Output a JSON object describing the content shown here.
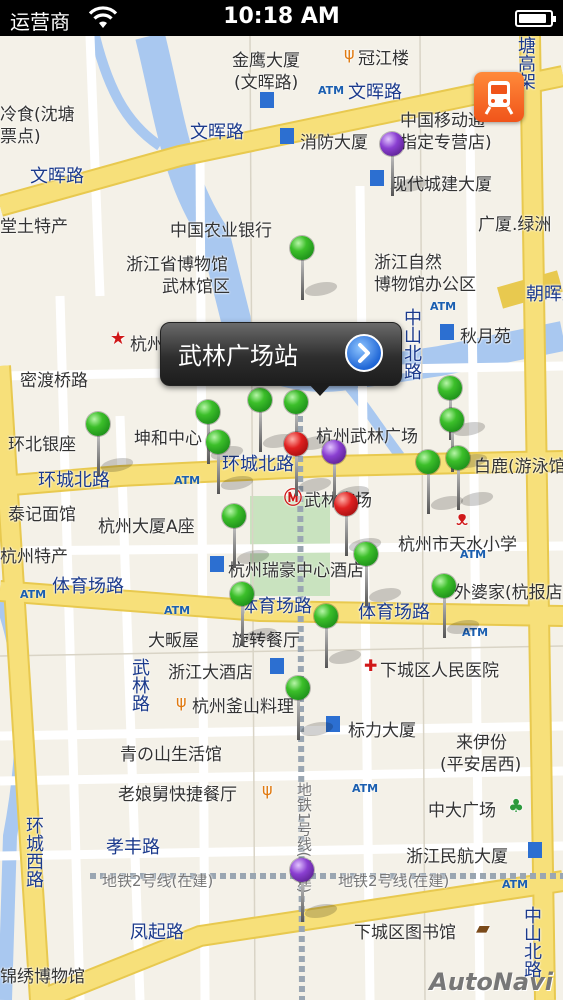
{
  "status_bar": {
    "carrier": "运营商",
    "time": "10:18 AM",
    "battery_level": 0.9
  },
  "callout": {
    "title": "武林广场站"
  },
  "watermark": "AutoNavi",
  "roads": {
    "wenhui_1": "文晖路",
    "wenhui_2": "文晖路",
    "wenhui_3": "文晖路",
    "huanchengbei_1": "环城北路",
    "huanchengbei_2": "环城北路",
    "tiyuchang_1": "体育场路",
    "tiyuchang_2": "体育场路",
    "tiyuchang_3": "体育场路",
    "zhongshanbei_1": "中山北路",
    "zhongshanbei_2": "中山北路",
    "fengqi": "凤起路",
    "wulin": "武林路",
    "huanchengxi": "环城西路",
    "xiaofeng": "孝丰路",
    "midu_bridge": "密渡桥路",
    "tangqiao": "塘高架",
    "chaohui": "朝晖路",
    "metro1": "地铁1号线(在建)",
    "metro2a": "地铁2号线(在建)",
    "metro2b": "地铁2号线(在建)"
  },
  "places": {
    "jinying": "金鹰大厦",
    "jinying_sub": "(文晖路)",
    "guanjilou": "冠江楼",
    "lengshi": "冷食(沈塘",
    "lengshi_sub": "票点)",
    "chinamobile": "中国移动通",
    "chinamobile_sub": "指定专营店)",
    "xiaofang": "消防大厦",
    "xiandai": "现代城建大厦",
    "tangtu": "堂土特产",
    "abc": "中国农业银行",
    "guangxia": "广厦.绿洲",
    "zj_museum": "浙江省博物馆",
    "zj_museum_sub": "武林馆区",
    "zj_nature": "浙江自然",
    "zj_nature_sub": "博物馆办公区",
    "exam": "杭州市教育考试院",
    "qiuyue": "秋月苑",
    "wulin_sq": "杭州武林广场",
    "huanbei_bank": "环北银座",
    "kunhe": "坤和中心",
    "bailu": "白鹿(游泳馆)",
    "taiji": "泰记面馆",
    "hz_tower": "杭州大厦A座",
    "wulin_sq2": "武林广场",
    "tianshui": "杭州市天水小学",
    "hz_tech": "杭州特产",
    "ruihao": "杭州瑞豪中心酒店",
    "waipo": "外婆家(杭报店)",
    "dafanwu": "大畈屋",
    "xuanzhuan": "旋转餐厅",
    "zj_hotel": "浙江大酒店",
    "xiacheng_hosp": "下城区人民医院",
    "fushan": "杭州釜山料理",
    "biaoli": "标力大厦",
    "laiyifen": "来伊份",
    "laiyifen_sub": "(平安居西)",
    "qingshan": "青の山生活馆",
    "laoniang": "老娘舅快捷餐厅",
    "zhongda": "中大广场",
    "zj_minhang": "浙江民航大厦",
    "xiacheng_lib": "下城区图书馆",
    "jinxiu": "锦绣博物馆"
  },
  "icons": {
    "metro_button": "metro-train-icon",
    "station_marker": "metro-station-icon"
  },
  "colors": {
    "map_bg": "#f4f1e8",
    "major_road": "#f7e07a",
    "minor_road": "#ffffff",
    "river": "#a9c8f0",
    "road_label": "#1b3a8c",
    "pin_green": "#3cbf2a",
    "pin_red": "#e02020",
    "pin_purple": "#8a3fd1",
    "metro_button": "#f0541a"
  }
}
